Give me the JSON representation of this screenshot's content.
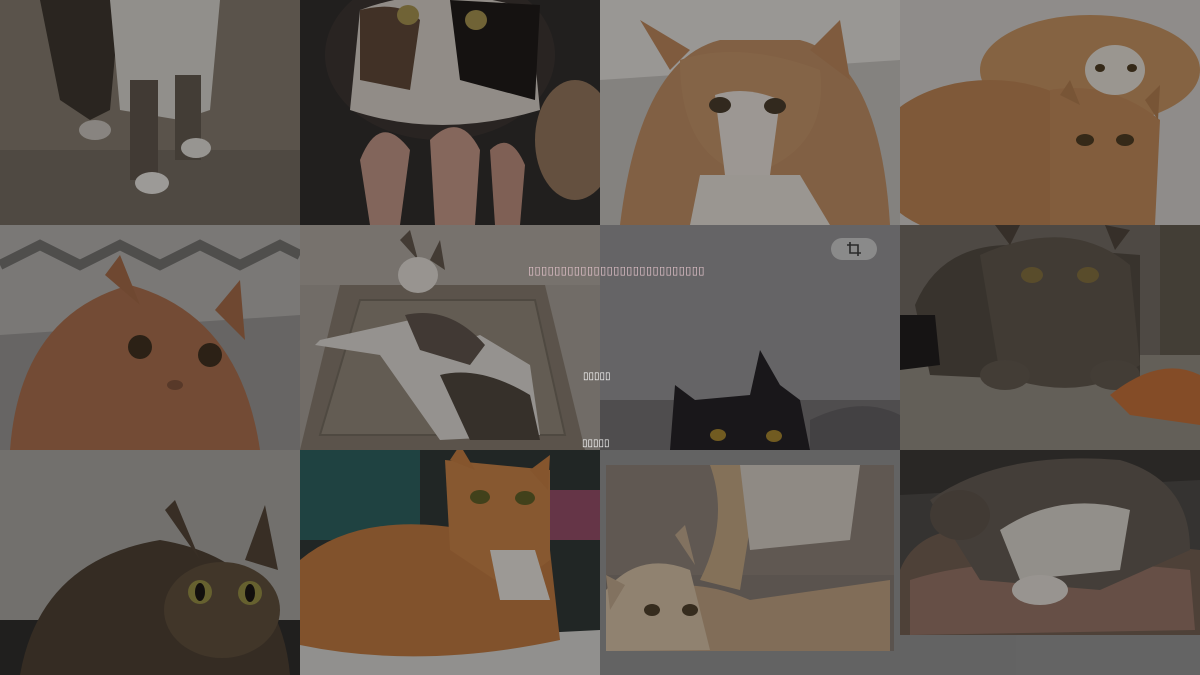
{
  "overlay": {
    "title_text": "▯▯▯▯▯▯▯▯▯▯▯▯▯▯▯▯▯▯▯▯▯▯▯▯▯▯▯",
    "option1_text": "▯▯▯▯▯",
    "option2_text": "▯▯▯▯▯"
  },
  "icons": {
    "crop": "crop-icon"
  },
  "colors": {
    "background": "#3a3a3a",
    "overlay_title": "#e8c7cf",
    "crop_button": "#8a8a8a"
  }
}
